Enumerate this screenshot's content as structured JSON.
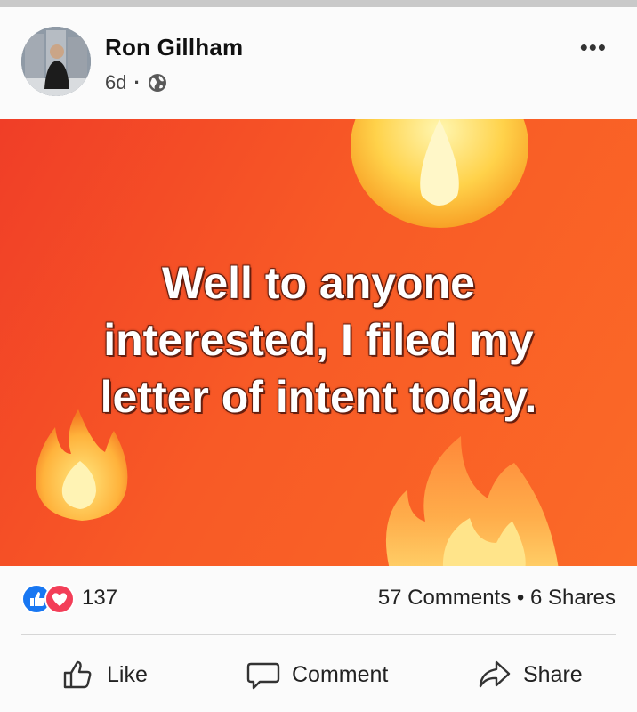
{
  "post": {
    "author": "Ron Gillham",
    "time": "6d",
    "separator": "·",
    "menu": "•••",
    "text": "Well to anyone interested, I filed my letter of intent today.",
    "text_lines": [
      "Well to anyone",
      "interested, I filed my",
      "letter of intent today."
    ],
    "background_color": "#f85a26"
  },
  "stats": {
    "reactions": [
      "like",
      "love"
    ],
    "reaction_count": "137",
    "comments_shares": "57 Comments • 6 Shares"
  },
  "actions": {
    "like": "Like",
    "comment": "Comment",
    "share": "Share"
  },
  "icons": {
    "privacy": "globe-icon",
    "like": "thumbs-up-icon",
    "comment": "speech-bubble-icon",
    "share": "share-arrow-icon"
  }
}
